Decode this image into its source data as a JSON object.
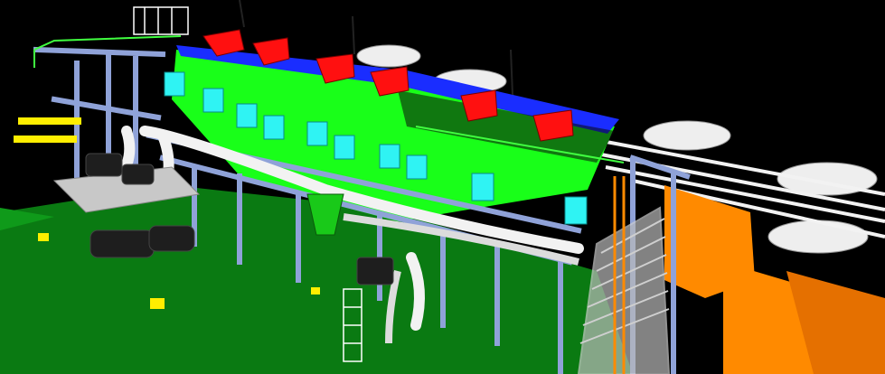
{
  "scene": {
    "subject": "",
    "colors": {
      "background": "#000000",
      "ground": "#0a7a12",
      "steel_frame": "#8fa2d8",
      "cell_tank": "#19ff19",
      "cell_motor": "#ff1010",
      "launder_box": "#2ff3f3",
      "pipe_white": "#f2f2f2",
      "concrete": "#c8c8c8",
      "baseplate": "#ffee00",
      "tank_orange": "#ff8a00",
      "dark_equipment": "#1e1e1e",
      "walkway_blue": "#1a2dff"
    }
  }
}
